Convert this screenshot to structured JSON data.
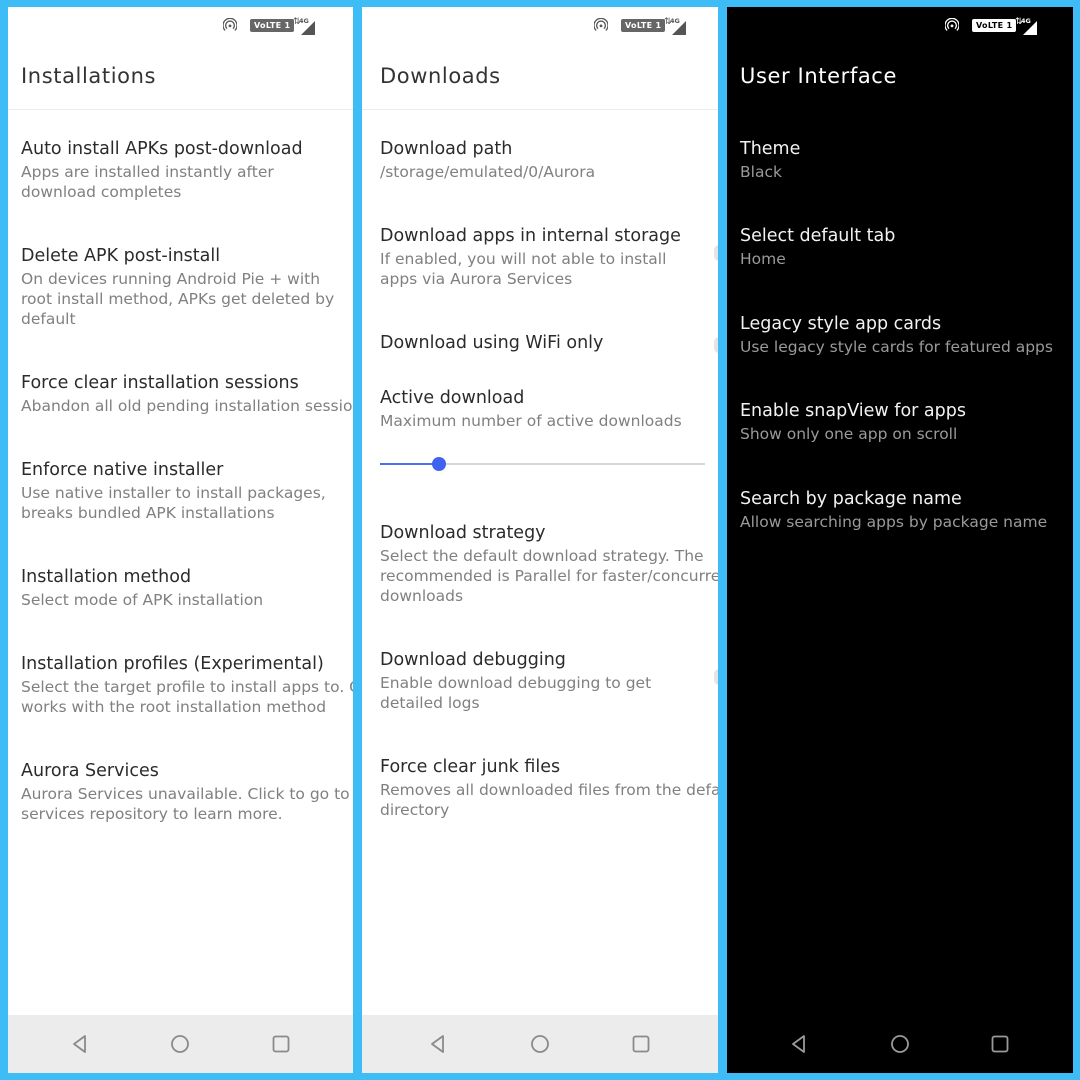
{
  "status_bar": {
    "volte_label": "VoLTE 1",
    "network_label": "4G"
  },
  "panels": [
    {
      "title": "Installations",
      "items": [
        {
          "title": "Auto install APKs post-download",
          "subtitle": "Apps are installed instantly after\ndownload completes"
        },
        {
          "title": "Delete APK post-install",
          "subtitle": "On devices running Android Pie + with\nroot install method, APKs get deleted by\ndefault"
        },
        {
          "title": "Force clear installation sessions",
          "subtitle": "Abandon all old pending installation sessions"
        },
        {
          "title": "Enforce native installer",
          "subtitle": "Use native installer to install packages,\nbreaks bundled APK installations"
        },
        {
          "title": "Installation method",
          "subtitle": "Select mode of APK installation"
        },
        {
          "title": "Installation profiles (Experimental)",
          "subtitle": "Select the target profile to install apps to. Only\nworks with the root installation method"
        },
        {
          "title": "Aurora Services",
          "subtitle": "Aurora Services unavailable. Click to go to the\nservices repository to learn more."
        }
      ]
    },
    {
      "title": "Downloads",
      "items": [
        {
          "title": "Download path",
          "subtitle": "/storage/emulated/0/Aurora"
        },
        {
          "title": "Download apps in internal storage",
          "subtitle": "If enabled, you will not able to install\napps via Aurora Services"
        },
        {
          "title": "Download using WiFi only",
          "subtitle": ""
        },
        {
          "title": "Active download",
          "subtitle": "Maximum number of active downloads"
        },
        {
          "title": "Download strategy",
          "subtitle": "Select the default download strategy. The\nrecommended is Parallel for faster/concurrent\ndownloads"
        },
        {
          "title": "Download debugging",
          "subtitle": "Enable download debugging to get\ndetailed logs"
        },
        {
          "title": "Force clear junk files",
          "subtitle": "Removes all downloaded files from the default\ndirectory"
        }
      ],
      "active_download_slider": {
        "value_fraction": 0.18
      }
    },
    {
      "title": "User Interface",
      "items": [
        {
          "title": "Theme",
          "subtitle": "Black"
        },
        {
          "title": "Select default tab",
          "subtitle": "Home"
        },
        {
          "title": "Legacy style app cards",
          "subtitle": "Use legacy style cards for featured apps"
        },
        {
          "title": "Enable snapView for apps",
          "subtitle": "Show only one app on scroll"
        },
        {
          "title": "Search by package name",
          "subtitle": "Allow searching apps by package name"
        }
      ]
    }
  ],
  "icons": {
    "hotspot": "hotspot-icon",
    "signal": "signal-icon",
    "data_arrows": "data-arrows-icon",
    "back": "back-triangle-icon",
    "home": "home-circle-icon",
    "recents": "recents-square-icon"
  },
  "colors": {
    "frame_blue": "#3dbcf6",
    "slider_accent": "#3f63ee",
    "light_bg": "#ffffff",
    "dark_bg": "#000000"
  }
}
